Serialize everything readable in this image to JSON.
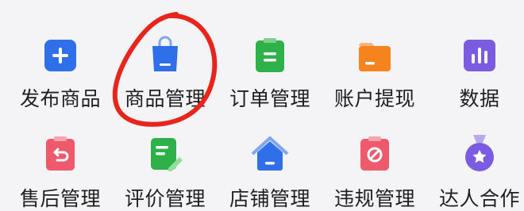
{
  "menu": {
    "row1": [
      {
        "label": "发布商品",
        "icon": "add-icon",
        "color": "#2f6fea"
      },
      {
        "label": "商品管理",
        "icon": "shopping-bag-icon",
        "color": "#2f6fea"
      },
      {
        "label": "订单管理",
        "icon": "order-clipboard-icon",
        "color": "#2fb14a"
      },
      {
        "label": "账户提现",
        "icon": "wallet-icon",
        "color": "#f5841f"
      },
      {
        "label": "数据",
        "icon": "bar-chart-icon",
        "color": "#7b5ce0"
      }
    ],
    "row2": [
      {
        "label": "售后管理",
        "icon": "return-clipboard-icon",
        "color": "#ee5a6c"
      },
      {
        "label": "评价管理",
        "icon": "review-edit-icon",
        "color": "#2fb14a"
      },
      {
        "label": "店铺管理",
        "icon": "store-home-icon",
        "color": "#2f6fea"
      },
      {
        "label": "违规管理",
        "icon": "violation-clipboard-icon",
        "color": "#ee5a6c"
      },
      {
        "label": "达人合作",
        "icon": "star-medal-icon",
        "color": "#7b5ce0"
      }
    ]
  },
  "annotation": {
    "color": "#e8241c",
    "target": "商品管理"
  }
}
